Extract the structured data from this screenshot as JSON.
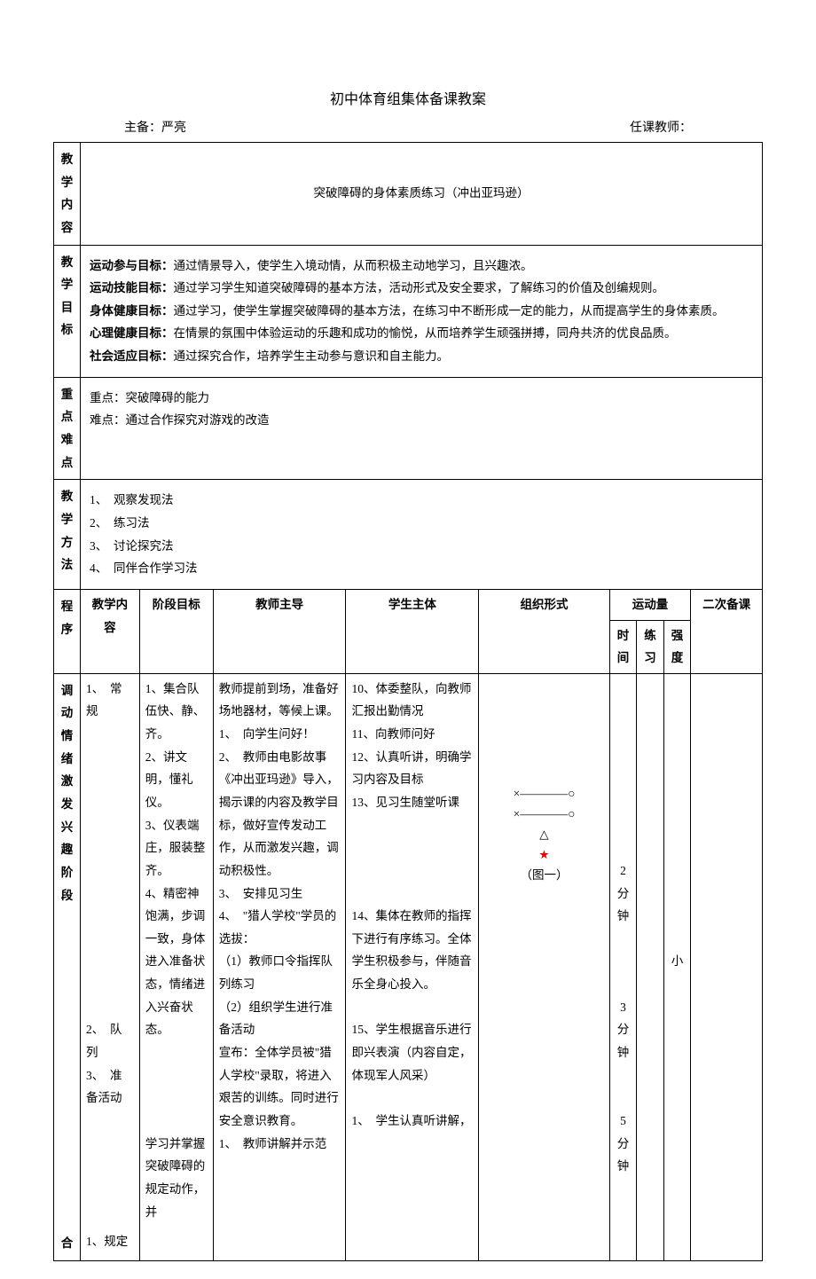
{
  "title": "初中体育组集体备课教案",
  "header": {
    "preparerLabel": "主备：",
    "preparerName": "严亮",
    "teacherLabel": "任课教师："
  },
  "rows": {
    "content": {
      "label": "教学内容",
      "value": "突破障碍的身体素质练习（冲出亚玛逊）"
    },
    "goals": {
      "label": "教学目标",
      "items": [
        {
          "b": "运动参与目标：",
          "t": "通过情景导入，使学生入境动情，从而积极主动地学习，且兴趣浓。"
        },
        {
          "b": "运动技能目标：",
          "t": "通过学习学生知道突破障碍的基本方法，活动形式及安全要求，了解练习的价值及创编规则。"
        },
        {
          "b": "身体健康目标：",
          "t": "通过学习，使学生掌握突破障碍的基本方法，在练习中不断形成一定的能力，从而提高学生的身体素质。"
        },
        {
          "b": "心理健康目标：",
          "t": "在情景的氛围中体验运动的乐趣和成功的愉悦，从而培养学生顽强拼搏，同舟共济的优良品质。"
        },
        {
          "b": "社会适应目标：",
          "t": "通过探究合作，培养学生主动参与意识和自主能力。"
        }
      ]
    },
    "keyPoints": {
      "label": "重点难点",
      "line1": "重点：突破障碍的能力",
      "line2": "难点：通过合作探究对游戏的改造"
    },
    "methods": {
      "label": "教学方法",
      "items": [
        "1、　观察发现法",
        "2、　练习法",
        "3、　讨论探究法",
        "4、　同伴合作学习法"
      ]
    }
  },
  "tableHead": {
    "seq": "程序",
    "teachContent": "教学内容",
    "stageGoal": "阶段目标",
    "teacherLead": "教师主导",
    "studentBody": "学生主体",
    "orgForm": "组织形式",
    "exercise": "运动量",
    "time": "时间",
    "lianxi": "练习",
    "qiangdu": "强度",
    "second": "二次备课"
  },
  "stage1": {
    "seq": "调动情绪激发兴趣阶段",
    "teachContent": "1、　常规\n\n\n\n\n\n\n\n\n\n\n\n\n\n2、　队列\n3、　准备活动",
    "stageGoal": "1、集合队伍快、静、齐。\n2、讲文明，懂礼仪。\n3、仪表端庄，服装整齐。\n4、精密神饱满，步调一致，身体进入准备状态，情绪进入兴奋状态。\n\n\n\n\n学习并掌握突破障碍的规定动作，并",
    "teacherLead": "教师提前到场，准备好场地器材，等候上课。\n1、　向学生问好！\n2、　教师由电影故事《冲出亚玛逊》导入，揭示课的内容及教学目标，做好宣传发动工作，从而激发兴趣，调动积极性。\n3、　安排见习生\n4、　\"猎人学校\"学员的选拔：\n（1）教师口令指挥队列练习\n（2）组织学生进行准备活动\n宣布：全体学员被\"猎人学校\"录取，将进入艰苦的训练。同时进行安全意识教育。\n1、　教师讲解并示范",
    "studentBody": "10、体委整队，向教师汇报出勤情况\n11、向教师问好\n12、认真听讲，明确学习内容及目标\n13、见习生随堂听课\n\n\n\n\n14、集体在教师的指挥下进行有序练习。全体学生积极参与，伴随音乐全身心投入。\n\n15、学生根据音乐进行即兴表演（内容自定，体现军人风采）\n\n1、　学生认真听讲解，",
    "orgForm": {
      "line1": "×————○",
      "line2": "×————○",
      "triangle": "△",
      "star": "★",
      "caption": "（图一）"
    },
    "time": "\n\n\n\n\n\n\n\n2分钟\n\n\n\n3分钟\n\n\n5分钟",
    "qiangdu": "\n\n\n\n\n\n\n\n\n\n\n\n小"
  },
  "stage2Label": "合",
  "stage2Teach": "1、规定"
}
